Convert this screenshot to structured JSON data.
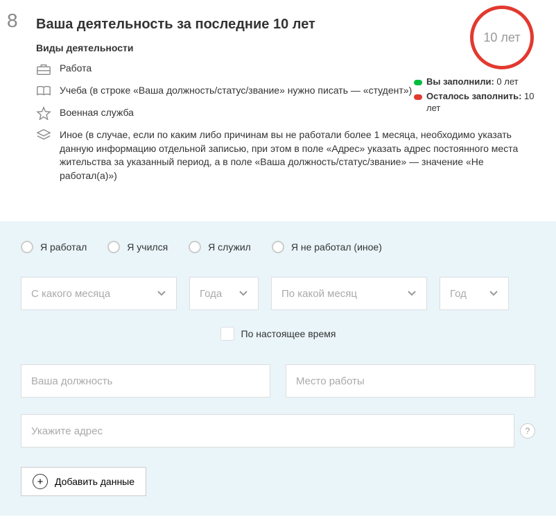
{
  "step": "8",
  "title": "Ваша деятельность за последние 10 лет",
  "subtitle": "Виды деятельности",
  "activities": {
    "work": "Работа",
    "study": "Учеба (в строке «Ваша должность/статус/звание» нужно писать — «студент»)",
    "military": "Военная служба",
    "other": "Иное (в случае, если по каким либо причинам вы не работали более 1 месяца, необходимо указать данную информацию отдельной записью, при этом в поле «Адрес» указать адрес постоянного места жительства за указанный период, а в поле «Ваша должность/статус/звание» — значение «Не работал(а)»)"
  },
  "circle_label": "10 лет",
  "stats": {
    "filled": {
      "label": "Вы заполнили:",
      "value": "0 лет"
    },
    "remaining": {
      "label": "Осталось заполнить:",
      "value": "10 лет"
    }
  },
  "form": {
    "radios": {
      "worked": "Я работал",
      "studied": "Я учился",
      "served": "Я служил",
      "none": "Я не работал (иное)"
    },
    "selects": {
      "from_month": "С какого месяца",
      "from_year": "Года",
      "to_month": "По какой месяц",
      "to_year": "Год"
    },
    "checkbox_present": "По настоящее время",
    "inputs": {
      "position": "Ваша должность",
      "workplace": "Место работы",
      "address": "Укажите адрес"
    },
    "help": "?",
    "add_button": "Добавить данные"
  }
}
